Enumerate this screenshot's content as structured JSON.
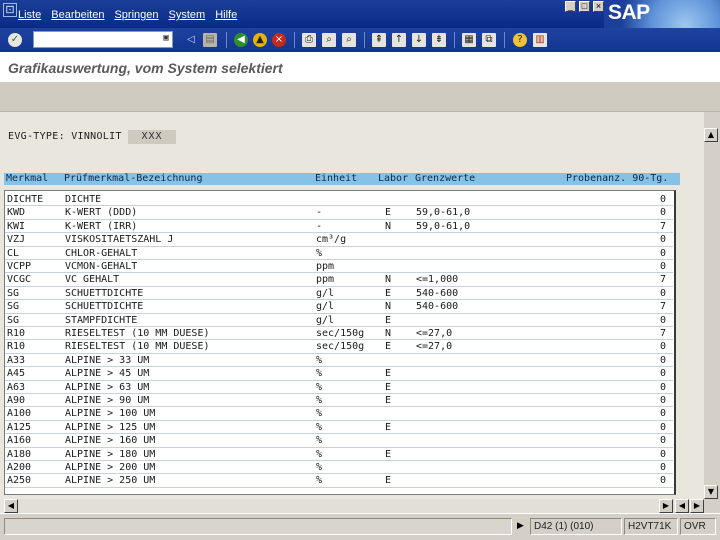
{
  "menu": {
    "items": [
      "Liste",
      "Bearbeiten",
      "Springen",
      "System",
      "Hilfe"
    ],
    "logo": "SAP"
  },
  "toolbar": {
    "command_value": "",
    "icons": [
      "enter-icon",
      "back-icon",
      "save-icon",
      "green-arrow-back-icon",
      "exit-icon",
      "cancel-icon",
      "print-icon",
      "find-icon",
      "find-next-icon",
      "first-page-icon",
      "prev-page-icon",
      "next-page-icon",
      "last-page-icon",
      "new-session-icon",
      "shortcut-icon",
      "help-icon",
      "layout-icon"
    ]
  },
  "title": "Grafikauswertung, vom System selektiert",
  "evg": {
    "label": "EVG-TYPE: VINNOLIT",
    "value": "XXX"
  },
  "table": {
    "headers": {
      "merkmal": "Merkmal",
      "bezeichnung": "Prüfmerkmal-Bezeichnung",
      "einheit": "Einheit",
      "labor": "Labor",
      "grenzwerte": "Grenzwerte",
      "proben": "Probenanz. 90-Tg."
    },
    "rows": [
      {
        "merkmal": "DICHTE",
        "bezeichnung": "DICHTE",
        "einheit": "",
        "labor": "",
        "grenzwerte": "",
        "proben": "0"
      },
      {
        "merkmal": "KWD",
        "bezeichnung": "K-WERT (DDD)",
        "einheit": "-",
        "labor": "E",
        "grenzwerte": "59,0-61,0",
        "proben": "0"
      },
      {
        "merkmal": "KWI",
        "bezeichnung": "K-WERT (IRR)",
        "einheit": "-",
        "labor": "N",
        "grenzwerte": "59,0-61,0",
        "proben": "7"
      },
      {
        "merkmal": "VZJ",
        "bezeichnung": "VISKOSITAETSZAHL J",
        "einheit": "cm³/g",
        "labor": "",
        "grenzwerte": "",
        "proben": "0"
      },
      {
        "merkmal": "CL",
        "bezeichnung": "CHLOR-GEHALT",
        "einheit": "%",
        "labor": "",
        "grenzwerte": "",
        "proben": "0"
      },
      {
        "merkmal": "VCPP",
        "bezeichnung": "VCMON-GEHALT",
        "einheit": "ppm",
        "labor": "",
        "grenzwerte": "",
        "proben": "0"
      },
      {
        "merkmal": "VCGC",
        "bezeichnung": "VC GEHALT",
        "einheit": "ppm",
        "labor": "N",
        "grenzwerte": "<=1,000",
        "proben": "7"
      },
      {
        "merkmal": "SG",
        "bezeichnung": "SCHUETTDICHTE",
        "einheit": "g/l",
        "labor": "E",
        "grenzwerte": "540-600",
        "proben": "0"
      },
      {
        "merkmal": "SG",
        "bezeichnung": "SCHUETTDICHTE",
        "einheit": "g/l",
        "labor": "N",
        "grenzwerte": "540-600",
        "proben": "7"
      },
      {
        "merkmal": "SG",
        "bezeichnung": "STAMPFDICHTE",
        "einheit": "g/l",
        "labor": "E",
        "grenzwerte": "",
        "proben": "0"
      },
      {
        "merkmal": "R10",
        "bezeichnung": "RIESELTEST (10 MM DUESE)",
        "einheit": "sec/150g",
        "labor": "N",
        "grenzwerte": "<=27,0",
        "proben": "7"
      },
      {
        "merkmal": "R10",
        "bezeichnung": "RIESELTEST (10 MM DUESE)",
        "einheit": "sec/150g",
        "labor": "E",
        "grenzwerte": "<=27,0",
        "proben": "0"
      },
      {
        "merkmal": "A33",
        "bezeichnung": "ALPINE > 33 UM",
        "einheit": "%",
        "labor": "",
        "grenzwerte": "",
        "proben": "0"
      },
      {
        "merkmal": "A45",
        "bezeichnung": "ALPINE > 45 UM",
        "einheit": "%",
        "labor": "E",
        "grenzwerte": "",
        "proben": "0"
      },
      {
        "merkmal": "A63",
        "bezeichnung": "ALPINE > 63 UM",
        "einheit": "%",
        "labor": "E",
        "grenzwerte": "",
        "proben": "0"
      },
      {
        "merkmal": "A90",
        "bezeichnung": "ALPINE > 90 UM",
        "einheit": "%",
        "labor": "E",
        "grenzwerte": "",
        "proben": "0"
      },
      {
        "merkmal": "A100",
        "bezeichnung": "ALPINE > 100 UM",
        "einheit": "%",
        "labor": "",
        "grenzwerte": "",
        "proben": "0"
      },
      {
        "merkmal": "A125",
        "bezeichnung": "ALPINE > 125 UM",
        "einheit": "%",
        "labor": "E",
        "grenzwerte": "",
        "proben": "0"
      },
      {
        "merkmal": "A160",
        "bezeichnung": "ALPINE > 160 UM",
        "einheit": "%",
        "labor": "",
        "grenzwerte": "",
        "proben": "0"
      },
      {
        "merkmal": "A180",
        "bezeichnung": "ALPINE > 180 UM",
        "einheit": "%",
        "labor": "E",
        "grenzwerte": "",
        "proben": "0"
      },
      {
        "merkmal": "A200",
        "bezeichnung": "ALPINE > 200 UM",
        "einheit": "%",
        "labor": "",
        "grenzwerte": "",
        "proben": "0"
      },
      {
        "merkmal": "A250",
        "bezeichnung": "ALPINE > 250 UM",
        "einheit": "%",
        "labor": "E",
        "grenzwerte": "",
        "proben": "0"
      }
    ]
  },
  "status": {
    "message": "",
    "session": "D42 (1) (010)",
    "server": "H2VT71K",
    "mode": "OVR"
  }
}
